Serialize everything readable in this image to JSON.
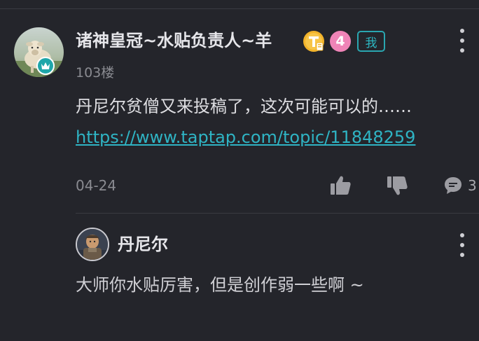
{
  "post": {
    "username": "诸神皇冠~水贴负责人~羊",
    "level": "4",
    "me_badge": "我",
    "floor": "103楼",
    "content": "丹尼尔贫僧又来投稿了，这次可能可以的……",
    "link": "https://www.taptap.com/topic/11848259",
    "date": "04-24",
    "reply_count": "3",
    "colors": {
      "background": "#24252b",
      "link": "#2fb4c4",
      "level_badge": "#ef84b7",
      "me_badge": "#2aa6b0"
    }
  },
  "reply": {
    "username": "丹尼尔",
    "content": "大师你水贴厉害，但是创作弱一些啊 ~"
  }
}
